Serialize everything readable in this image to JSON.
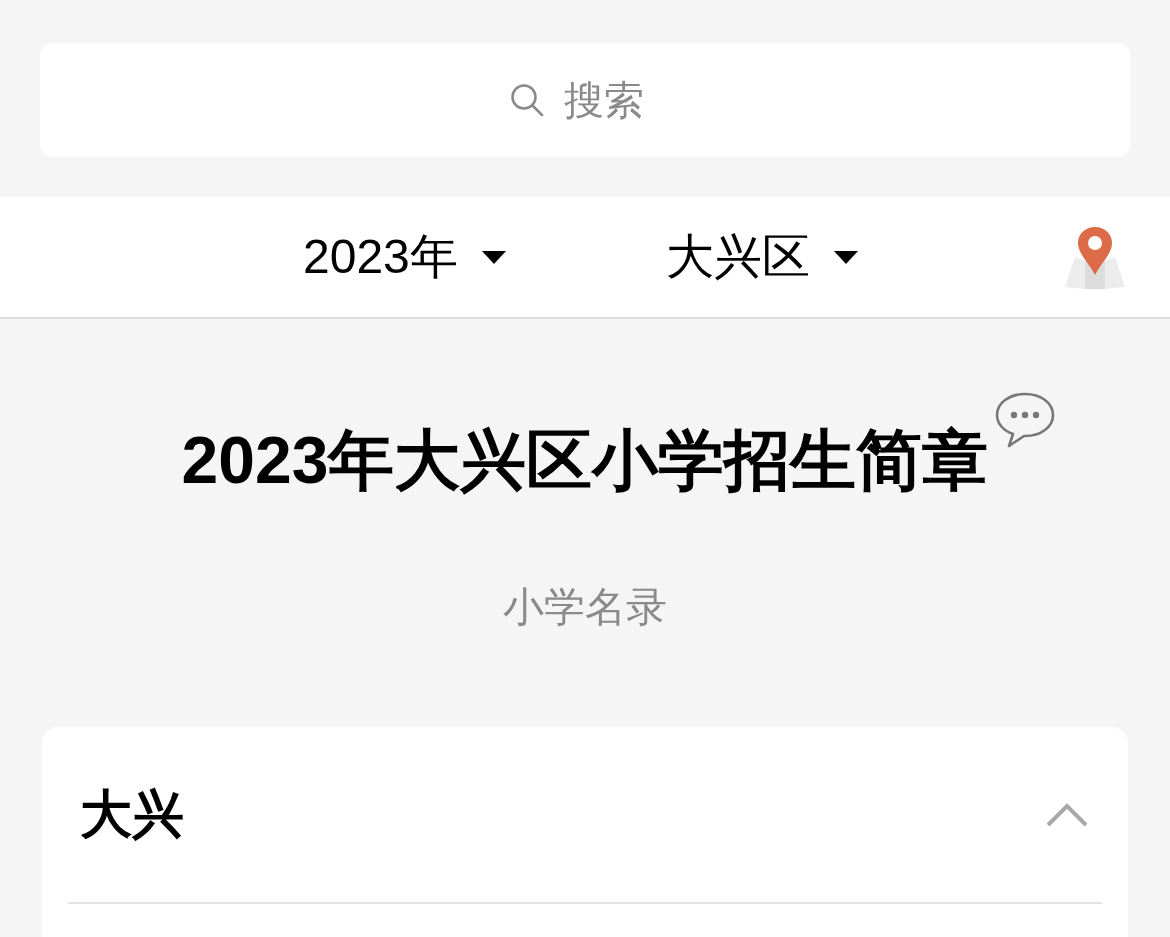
{
  "search": {
    "placeholder": "搜索"
  },
  "filters": [
    {
      "label": "2023年"
    },
    {
      "label": "大兴区"
    }
  ],
  "title": "2023年大兴区小学招生简章",
  "subtitle": "小学名录",
  "sections": [
    {
      "title": "大兴",
      "expanded": true
    }
  ]
}
